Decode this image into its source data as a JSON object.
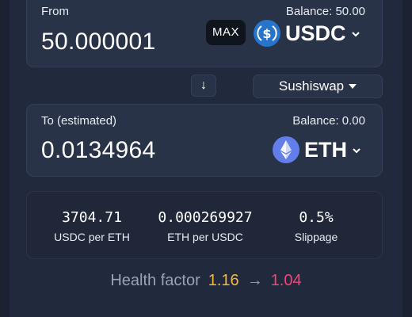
{
  "from": {
    "label": "From",
    "balance": "Balance: 50.00",
    "amount": "50.000001",
    "max_label": "MAX",
    "token_symbol": "USDC",
    "token_icon": "usdc-icon",
    "token_color": "#2775ca"
  },
  "swap_button": {
    "icon": "arrow-down-icon",
    "glyph": "↓"
  },
  "route": {
    "label": "Sushiswap"
  },
  "to": {
    "label": "To (estimated)",
    "balance": "Balance: 0.00",
    "amount": "0.0134964",
    "token_symbol": "ETH",
    "token_icon": "eth-icon",
    "token_color": "#627eea"
  },
  "stats": [
    {
      "value": "3704.71",
      "label": "USDC per ETH"
    },
    {
      "value": "0.000269927",
      "label": "ETH per USDC"
    },
    {
      "value": "0.5%",
      "label": "Slippage"
    }
  ],
  "health": {
    "label": "Health factor",
    "from_value": "1.16",
    "arrow": "→",
    "to_value": "1.04",
    "from_color": "#f4b73f",
    "to_color": "#f0457a"
  }
}
